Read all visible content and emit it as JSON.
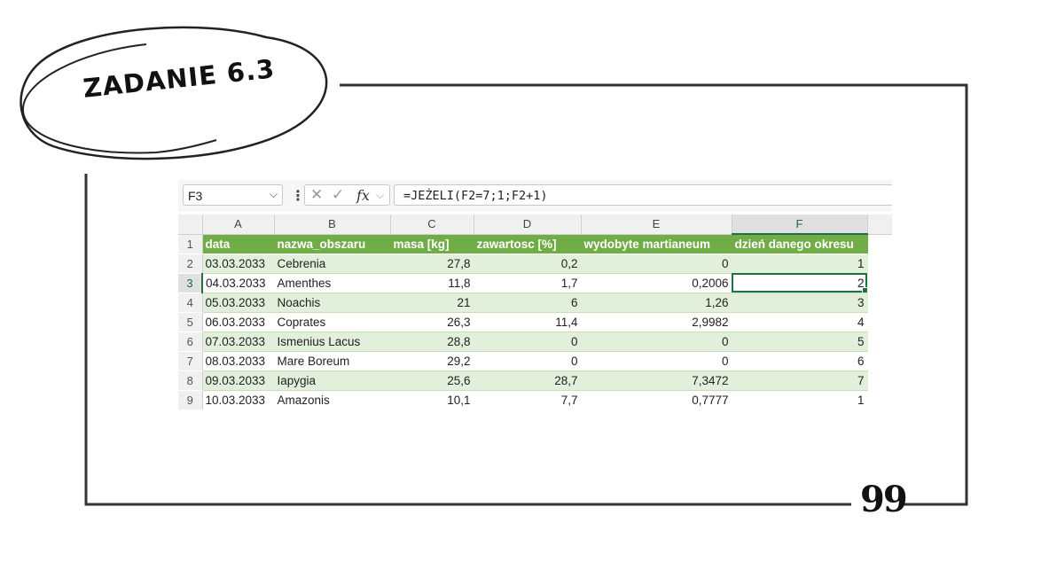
{
  "badge": {
    "text": "ZADANIE 6.3"
  },
  "quote_glyph": "99",
  "formula_bar": {
    "name_box": "F3",
    "dropdown_glyph": "⌵",
    "dots_glyph": "⋮",
    "cancel_glyph": "✕",
    "enter_glyph": "✓",
    "fx_label": "fx",
    "formula": "=JEŻELI(F2=7;1;F2+1)"
  },
  "columns": [
    "A",
    "B",
    "C",
    "D",
    "E",
    "F"
  ],
  "row_numbers": [
    "1",
    "2",
    "3",
    "4",
    "5",
    "6",
    "7",
    "8",
    "9"
  ],
  "header": [
    "data",
    "nazwa_obszaru",
    "masa [kg]",
    "zawartosc [%]",
    "wydobyte martianeum",
    "dzień danego okresu"
  ],
  "rows": [
    [
      "03.03.2033",
      "Cebrenia",
      "27,8",
      "0,2",
      "0",
      "1"
    ],
    [
      "04.03.2033",
      "Amenthes",
      "11,8",
      "1,7",
      "0,2006",
      "2"
    ],
    [
      "05.03.2033",
      "Noachis",
      "21",
      "6",
      "1,26",
      "3"
    ],
    [
      "06.03.2033",
      "Coprates",
      "26,3",
      "11,4",
      "2,9982",
      "4"
    ],
    [
      "07.03.2033",
      "Ismenius Lacus",
      "28,8",
      "0",
      "0",
      "5"
    ],
    [
      "08.03.2033",
      "Mare Boreum",
      "29,2",
      "0",
      "0",
      "6"
    ],
    [
      "09.03.2033",
      "Iapygia",
      "25,6",
      "28,7",
      "7,3472",
      "7"
    ],
    [
      "10.03.2033",
      "Amazonis",
      "10,1",
      "7,7",
      "0,7777",
      "1"
    ]
  ],
  "selection": {
    "column": "F",
    "row": "3"
  },
  "colors": {
    "header_green": "#70ad47",
    "band_green": "#e2efda",
    "accent": "#1e7145"
  }
}
